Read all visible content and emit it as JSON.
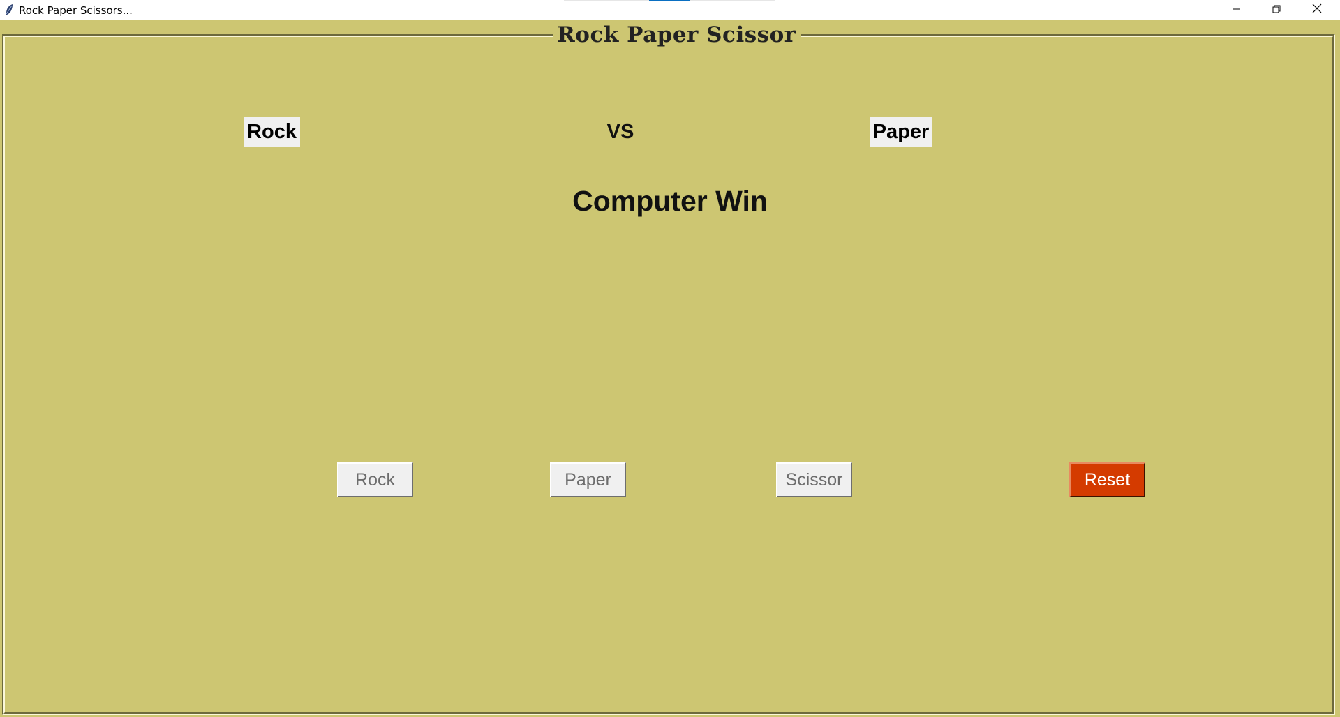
{
  "window": {
    "title": "Rock Paper Scissors..."
  },
  "frame": {
    "title": "Rock Paper Scissor"
  },
  "game": {
    "player_choice": "Rock",
    "vs_text": "VS",
    "computer_choice": "Paper",
    "result": "Computer Win"
  },
  "buttons": {
    "rock": "Rock",
    "paper": "Paper",
    "scissor": "Scissor",
    "reset": "Reset"
  },
  "colors": {
    "background": "#cdc672",
    "reset_button": "#d43b00",
    "label_background": "#f0f0f0"
  },
  "icons": {
    "app": "feather-icon",
    "minimize": "minimize-icon",
    "restore": "restore-icon",
    "close": "close-icon"
  }
}
